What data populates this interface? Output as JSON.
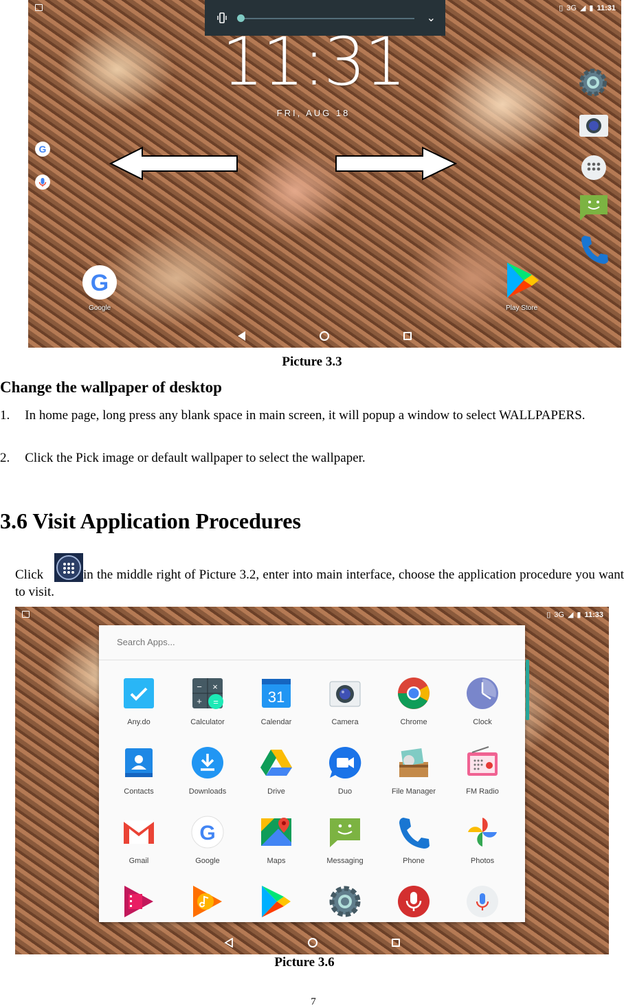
{
  "picture_a": {
    "caption": "Picture 3.3",
    "status_time": "11:31",
    "status_network": "3G",
    "clock": "11:31",
    "date": "FRI, AUG 18",
    "google_label": "Google",
    "playstore_label": "Play Store"
  },
  "section_wallpaper": {
    "heading": "Change the wallpaper of desktop",
    "step1_num": "1.",
    "step1_text": "In home page, long press any blank space in main screen, it will popup a window to select WALLPAPERS.",
    "step2_num": "2.",
    "step2_text": "Click the Pick image or default wallpaper to select the wallpaper."
  },
  "section_apps": {
    "heading": "3.6 Visit Application Procedures",
    "click_word": "Click",
    "para_rest": "in the middle right of Picture 3.2, enter into main interface, choose the application procedure you want to visit."
  },
  "picture_b": {
    "caption": "Picture 3.6",
    "status_time": "11:33",
    "status_network": "3G",
    "search_placeholder": "Search Apps...",
    "apps": [
      {
        "label": "Any.do"
      },
      {
        "label": "Calculator"
      },
      {
        "label": "Calendar"
      },
      {
        "label": "Camera"
      },
      {
        "label": "Chrome"
      },
      {
        "label": "Clock"
      },
      {
        "label": "Contacts"
      },
      {
        "label": "Downloads"
      },
      {
        "label": "Drive"
      },
      {
        "label": "Duo"
      },
      {
        "label": "File Manager"
      },
      {
        "label": "FM Radio"
      },
      {
        "label": "Gmail"
      },
      {
        "label": "Google"
      },
      {
        "label": "Maps"
      },
      {
        "label": "Messaging"
      },
      {
        "label": "Phone"
      },
      {
        "label": "Photos"
      }
    ],
    "calendar_day": "31"
  },
  "page_number": "7"
}
